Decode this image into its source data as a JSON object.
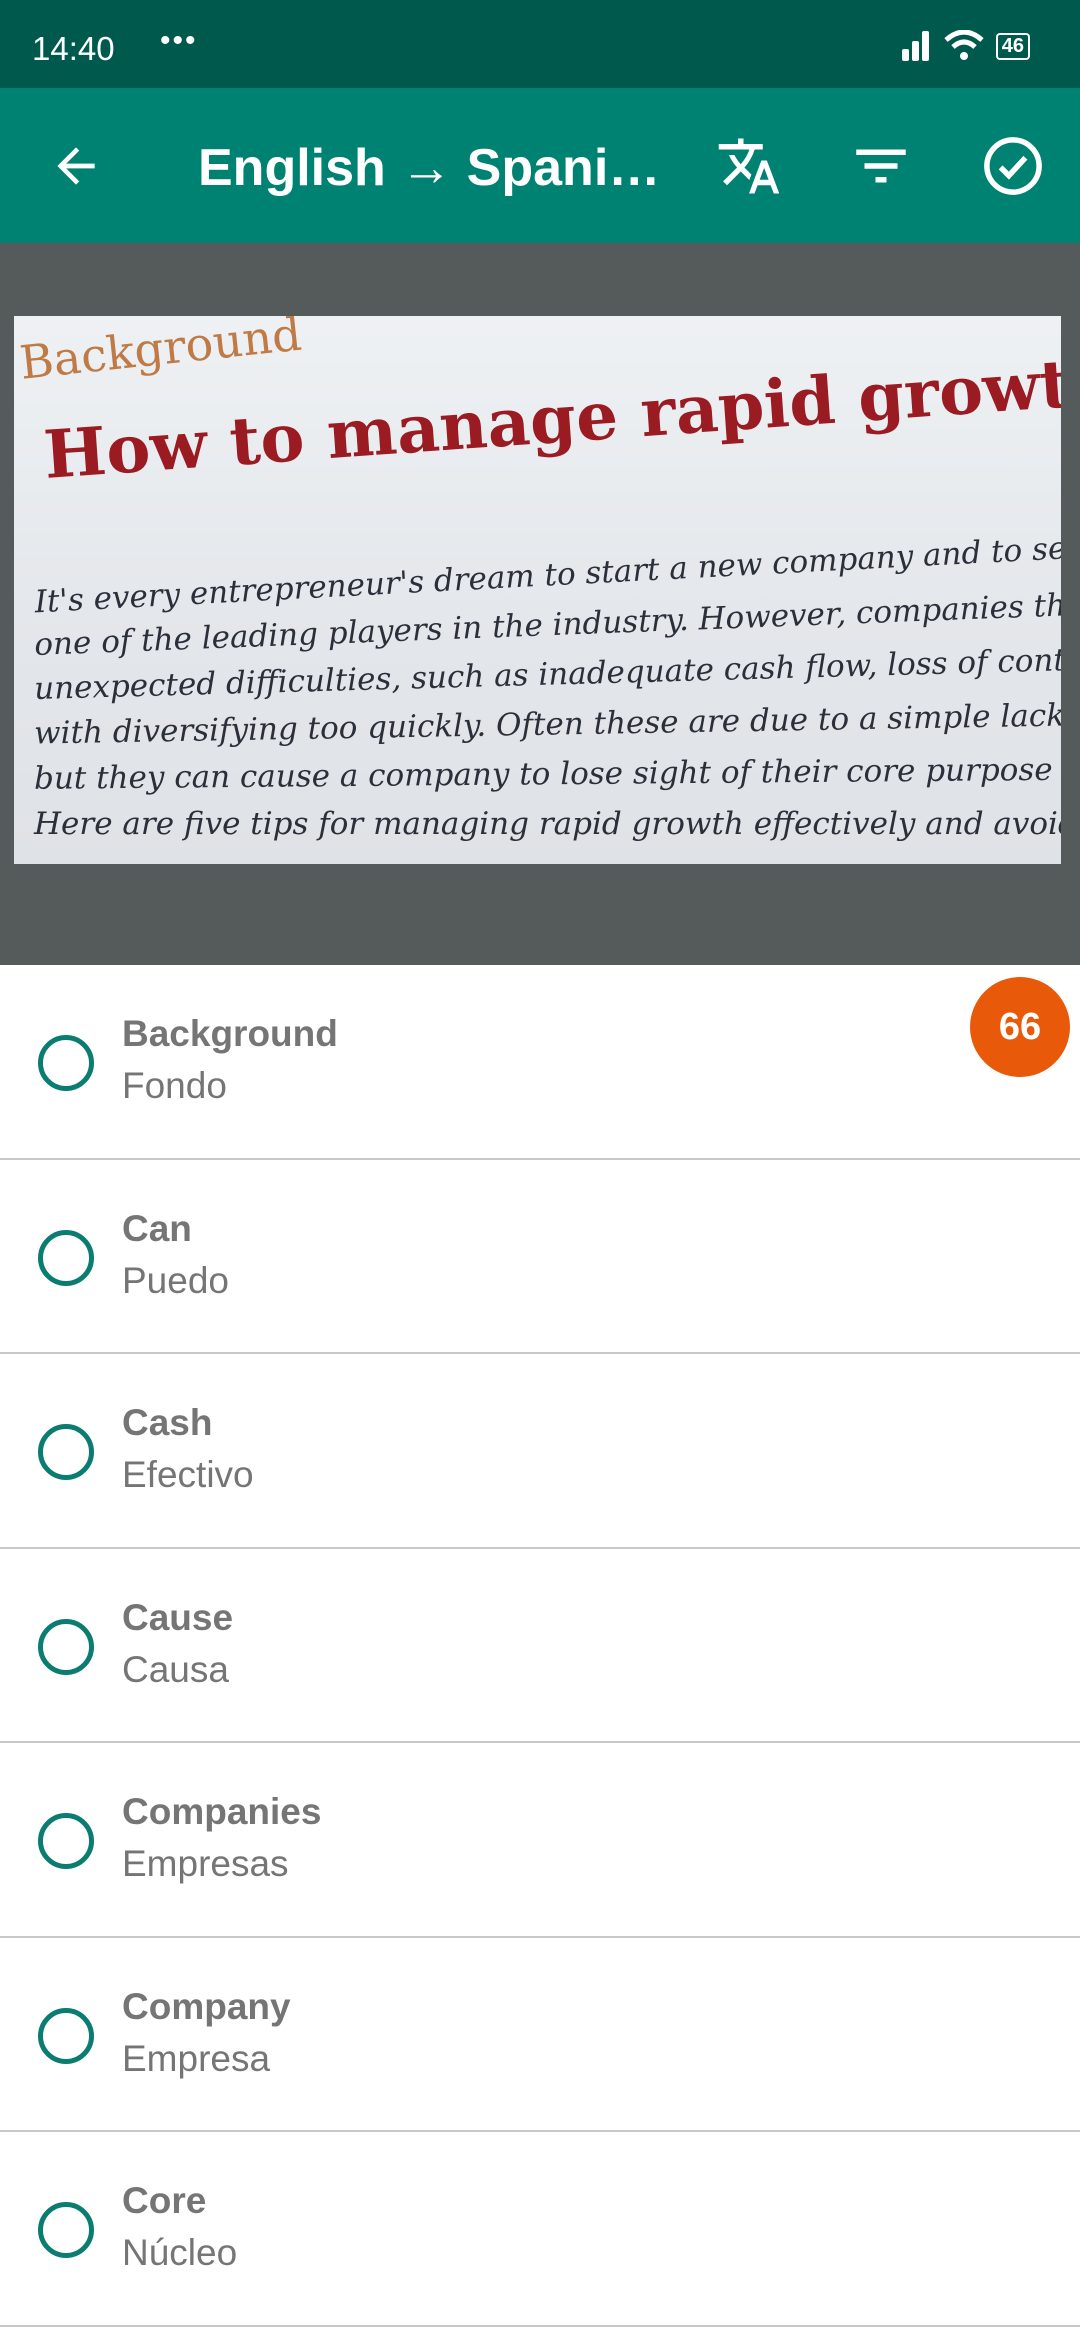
{
  "status_bar": {
    "time": "14:40",
    "notification_dots": "•••",
    "battery": "46"
  },
  "app_bar": {
    "title": "English → Spani…",
    "back_icon": "arrow-back-icon",
    "translate_icon": "translate-icon",
    "filter_icon": "filter-icon",
    "done_icon": "check-circle-icon"
  },
  "photo": {
    "label": "Background",
    "heading": "How to manage rapid growth",
    "lines": [
      "It's every entrepreneur's dream to start a new company and to see it",
      "one of the leading players in the industry. However, companies that g",
      "unexpected difficulties, such as inadequate cash flow, loss of control",
      "with diversifying too quickly. Often these are due to a simple lack of r",
      "but they can cause a company to lose sight of their core purpose and",
      "Here are five tips for managing rapid growth effectively and avoidir"
    ]
  },
  "badge": {
    "count": "66",
    "color": "#e85a0a"
  },
  "accent": "#008272",
  "words": [
    {
      "word": "Background",
      "translation": "Fondo"
    },
    {
      "word": "Can",
      "translation": "Puedo"
    },
    {
      "word": "Cash",
      "translation": "Efectivo"
    },
    {
      "word": "Cause",
      "translation": "Causa"
    },
    {
      "word": "Companies",
      "translation": "Empresas"
    },
    {
      "word": "Company",
      "translation": "Empresa"
    },
    {
      "word": "Core",
      "translation": "Núcleo"
    }
  ]
}
